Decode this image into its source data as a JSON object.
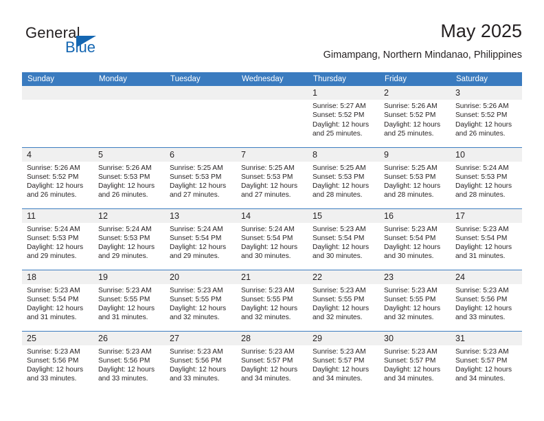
{
  "logo": {
    "word_top": "General",
    "word_bottom": "Blue",
    "accent_color": "#1567b2"
  },
  "header": {
    "title": "May 2025",
    "subtitle": "Gimampang, Northern Mindanao, Philippines"
  },
  "theme": {
    "header_bg": "#3a7bbf",
    "daynum_bg": "#f0f0f0",
    "text": "#231f20"
  },
  "calendar": {
    "weekday_headers": [
      "Sunday",
      "Monday",
      "Tuesday",
      "Wednesday",
      "Thursday",
      "Friday",
      "Saturday"
    ],
    "weeks": [
      [
        {
          "day": "",
          "empty": true
        },
        {
          "day": "",
          "empty": true
        },
        {
          "day": "",
          "empty": true
        },
        {
          "day": "",
          "empty": true
        },
        {
          "day": "1",
          "sunrise": "Sunrise: 5:27 AM",
          "sunset": "Sunset: 5:52 PM",
          "daylight": "Daylight: 12 hours and 25 minutes."
        },
        {
          "day": "2",
          "sunrise": "Sunrise: 5:26 AM",
          "sunset": "Sunset: 5:52 PM",
          "daylight": "Daylight: 12 hours and 25 minutes."
        },
        {
          "day": "3",
          "sunrise": "Sunrise: 5:26 AM",
          "sunset": "Sunset: 5:52 PM",
          "daylight": "Daylight: 12 hours and 26 minutes."
        }
      ],
      [
        {
          "day": "4",
          "sunrise": "Sunrise: 5:26 AM",
          "sunset": "Sunset: 5:52 PM",
          "daylight": "Daylight: 12 hours and 26 minutes."
        },
        {
          "day": "5",
          "sunrise": "Sunrise: 5:26 AM",
          "sunset": "Sunset: 5:53 PM",
          "daylight": "Daylight: 12 hours and 26 minutes."
        },
        {
          "day": "6",
          "sunrise": "Sunrise: 5:25 AM",
          "sunset": "Sunset: 5:53 PM",
          "daylight": "Daylight: 12 hours and 27 minutes."
        },
        {
          "day": "7",
          "sunrise": "Sunrise: 5:25 AM",
          "sunset": "Sunset: 5:53 PM",
          "daylight": "Daylight: 12 hours and 27 minutes."
        },
        {
          "day": "8",
          "sunrise": "Sunrise: 5:25 AM",
          "sunset": "Sunset: 5:53 PM",
          "daylight": "Daylight: 12 hours and 28 minutes."
        },
        {
          "day": "9",
          "sunrise": "Sunrise: 5:25 AM",
          "sunset": "Sunset: 5:53 PM",
          "daylight": "Daylight: 12 hours and 28 minutes."
        },
        {
          "day": "10",
          "sunrise": "Sunrise: 5:24 AM",
          "sunset": "Sunset: 5:53 PM",
          "daylight": "Daylight: 12 hours and 28 minutes."
        }
      ],
      [
        {
          "day": "11",
          "sunrise": "Sunrise: 5:24 AM",
          "sunset": "Sunset: 5:53 PM",
          "daylight": "Daylight: 12 hours and 29 minutes."
        },
        {
          "day": "12",
          "sunrise": "Sunrise: 5:24 AM",
          "sunset": "Sunset: 5:53 PM",
          "daylight": "Daylight: 12 hours and 29 minutes."
        },
        {
          "day": "13",
          "sunrise": "Sunrise: 5:24 AM",
          "sunset": "Sunset: 5:54 PM",
          "daylight": "Daylight: 12 hours and 29 minutes."
        },
        {
          "day": "14",
          "sunrise": "Sunrise: 5:24 AM",
          "sunset": "Sunset: 5:54 PM",
          "daylight": "Daylight: 12 hours and 30 minutes."
        },
        {
          "day": "15",
          "sunrise": "Sunrise: 5:23 AM",
          "sunset": "Sunset: 5:54 PM",
          "daylight": "Daylight: 12 hours and 30 minutes."
        },
        {
          "day": "16",
          "sunrise": "Sunrise: 5:23 AM",
          "sunset": "Sunset: 5:54 PM",
          "daylight": "Daylight: 12 hours and 30 minutes."
        },
        {
          "day": "17",
          "sunrise": "Sunrise: 5:23 AM",
          "sunset": "Sunset: 5:54 PM",
          "daylight": "Daylight: 12 hours and 31 minutes."
        }
      ],
      [
        {
          "day": "18",
          "sunrise": "Sunrise: 5:23 AM",
          "sunset": "Sunset: 5:54 PM",
          "daylight": "Daylight: 12 hours and 31 minutes."
        },
        {
          "day": "19",
          "sunrise": "Sunrise: 5:23 AM",
          "sunset": "Sunset: 5:55 PM",
          "daylight": "Daylight: 12 hours and 31 minutes."
        },
        {
          "day": "20",
          "sunrise": "Sunrise: 5:23 AM",
          "sunset": "Sunset: 5:55 PM",
          "daylight": "Daylight: 12 hours and 32 minutes."
        },
        {
          "day": "21",
          "sunrise": "Sunrise: 5:23 AM",
          "sunset": "Sunset: 5:55 PM",
          "daylight": "Daylight: 12 hours and 32 minutes."
        },
        {
          "day": "22",
          "sunrise": "Sunrise: 5:23 AM",
          "sunset": "Sunset: 5:55 PM",
          "daylight": "Daylight: 12 hours and 32 minutes."
        },
        {
          "day": "23",
          "sunrise": "Sunrise: 5:23 AM",
          "sunset": "Sunset: 5:55 PM",
          "daylight": "Daylight: 12 hours and 32 minutes."
        },
        {
          "day": "24",
          "sunrise": "Sunrise: 5:23 AM",
          "sunset": "Sunset: 5:56 PM",
          "daylight": "Daylight: 12 hours and 33 minutes."
        }
      ],
      [
        {
          "day": "25",
          "sunrise": "Sunrise: 5:23 AM",
          "sunset": "Sunset: 5:56 PM",
          "daylight": "Daylight: 12 hours and 33 minutes."
        },
        {
          "day": "26",
          "sunrise": "Sunrise: 5:23 AM",
          "sunset": "Sunset: 5:56 PM",
          "daylight": "Daylight: 12 hours and 33 minutes."
        },
        {
          "day": "27",
          "sunrise": "Sunrise: 5:23 AM",
          "sunset": "Sunset: 5:56 PM",
          "daylight": "Daylight: 12 hours and 33 minutes."
        },
        {
          "day": "28",
          "sunrise": "Sunrise: 5:23 AM",
          "sunset": "Sunset: 5:57 PM",
          "daylight": "Daylight: 12 hours and 34 minutes."
        },
        {
          "day": "29",
          "sunrise": "Sunrise: 5:23 AM",
          "sunset": "Sunset: 5:57 PM",
          "daylight": "Daylight: 12 hours and 34 minutes."
        },
        {
          "day": "30",
          "sunrise": "Sunrise: 5:23 AM",
          "sunset": "Sunset: 5:57 PM",
          "daylight": "Daylight: 12 hours and 34 minutes."
        },
        {
          "day": "31",
          "sunrise": "Sunrise: 5:23 AM",
          "sunset": "Sunset: 5:57 PM",
          "daylight": "Daylight: 12 hours and 34 minutes."
        }
      ]
    ]
  }
}
